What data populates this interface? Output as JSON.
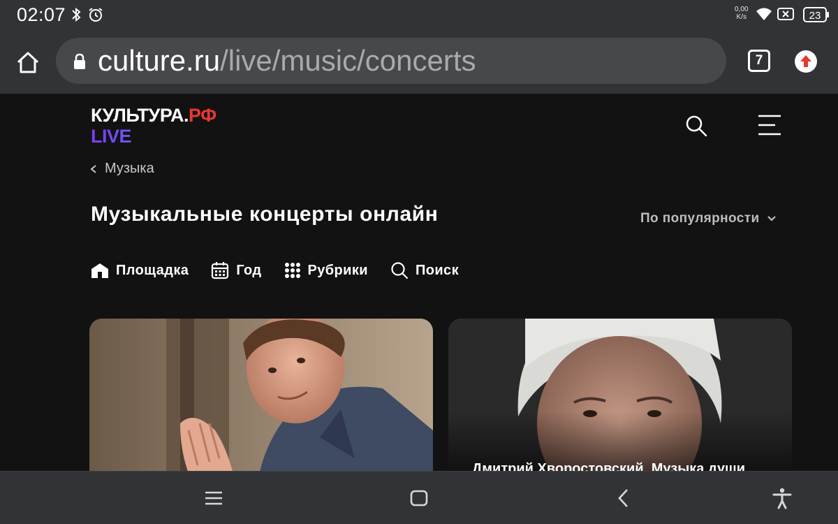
{
  "status_bar": {
    "time": "02:07",
    "net_speed_value": "0,00",
    "net_speed_unit": "K/s",
    "battery": "23",
    "icons": [
      "bluetooth-icon",
      "alarm-icon",
      "wifi-icon",
      "signal-off-icon",
      "battery-icon"
    ]
  },
  "browser": {
    "url_host": "culture.ru",
    "url_path": "/live/music/concerts",
    "tab_count": "7"
  },
  "site": {
    "logo_main": "КУЛЬТУРА.",
    "logo_rf": "РФ",
    "logo_live": "LIVE",
    "breadcrumb": "Музыка",
    "title": "Музыкальные концерты онлайн",
    "sort_label": "По популярности",
    "filters": [
      {
        "label": "Площадка",
        "icon": "venue-icon"
      },
      {
        "label": "Год",
        "icon": "calendar-icon"
      },
      {
        "label": "Рубрики",
        "icon": "grid-icon"
      },
      {
        "label": "Поиск",
        "icon": "search-icon"
      }
    ],
    "cards": [
      {
        "title": ""
      },
      {
        "title": "Дмитрий Хворостовский. Музыка души"
      }
    ]
  },
  "colors": {
    "background": "#121212",
    "chrome": "#323336",
    "url_box": "#47484b",
    "logo_rf": "#e8392f",
    "update_accent": "#e23a2f"
  }
}
